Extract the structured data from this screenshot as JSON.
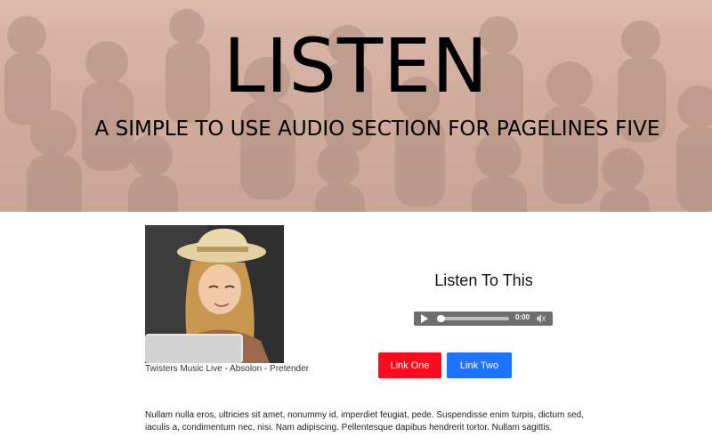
{
  "hero": {
    "title": "LISTEN",
    "subtitle": "A SIMPLE TO USE AUDIO SECTION FOR PAGELINES FIVE"
  },
  "media": {
    "caption": "Twisters Music Live - Absolon - Pretender"
  },
  "player": {
    "heading": "Listen To This",
    "time": "0:00",
    "progress": 0
  },
  "buttons": {
    "one_label": "Link One",
    "two_label": "Link Two"
  },
  "content": {
    "paragraph": "Nullam nulla eros, ultricies sit amet, nonummy id, imperdiet feugiat, pede. Suspendisse enim turpis, dictum sed, iaculis a, condimentum nec, nisi. Nam adipiscing. Pellentesque dapibus hendrerit tortor. Nullam sagittis."
  },
  "colors": {
    "link_one": "#ff0a1f",
    "link_two": "#1e73ff",
    "player_bg": "#6d6d6d"
  },
  "icons": {
    "play": "play-icon",
    "mute": "mute-icon"
  }
}
